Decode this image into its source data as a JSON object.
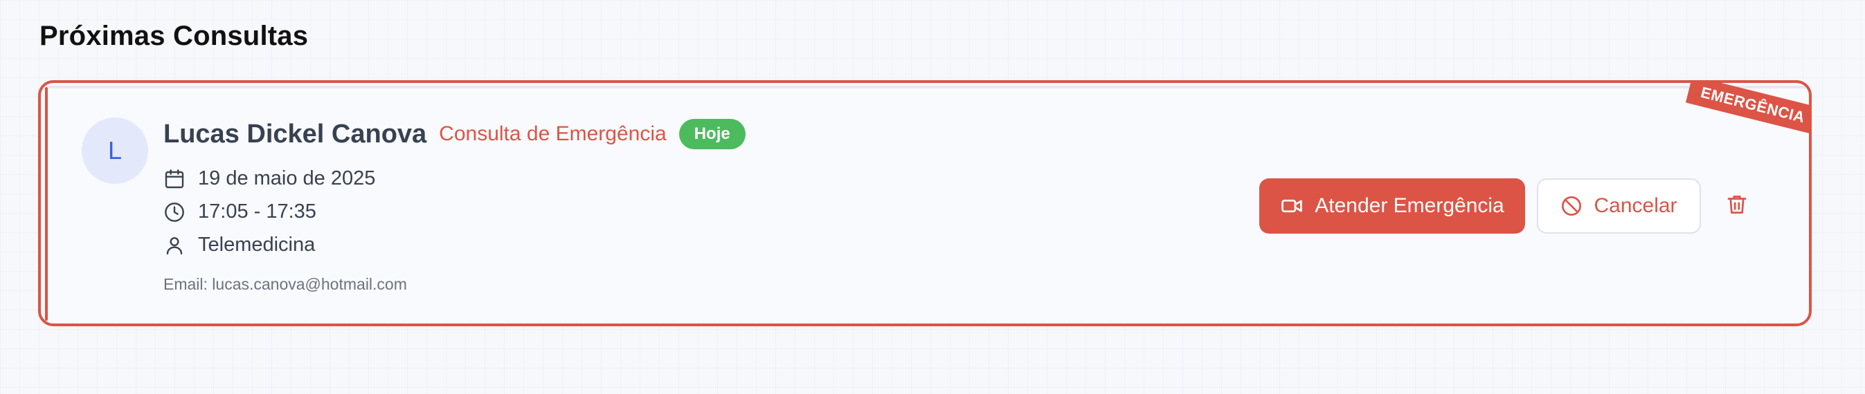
{
  "section": {
    "title": "Próximas Consultas"
  },
  "appointment": {
    "ribbon": "EMERGÊNCIA",
    "avatar_initial": "L",
    "patient_name": "Lucas Dickel Canova",
    "consult_type": "Consulta de Emergência",
    "badge": "Hoje",
    "date": "19 de maio de 2025",
    "time": "17:05 - 17:35",
    "mode": "Telemedicina",
    "email": "Email: lucas.canova@hotmail.com",
    "icons": {
      "date": "calendar-icon",
      "time": "clock-icon",
      "mode": "user-icon",
      "attend": "video-camera-icon",
      "cancel": "ban-icon",
      "delete": "trash-icon"
    }
  },
  "actions": {
    "attend_label": "Atender Emergência",
    "cancel_label": "Cancelar"
  },
  "colors": {
    "accent": "#dc5446",
    "badge_green": "#4cbb5d",
    "avatar_bg": "#e3e9fb",
    "avatar_text": "#3b63d8"
  }
}
